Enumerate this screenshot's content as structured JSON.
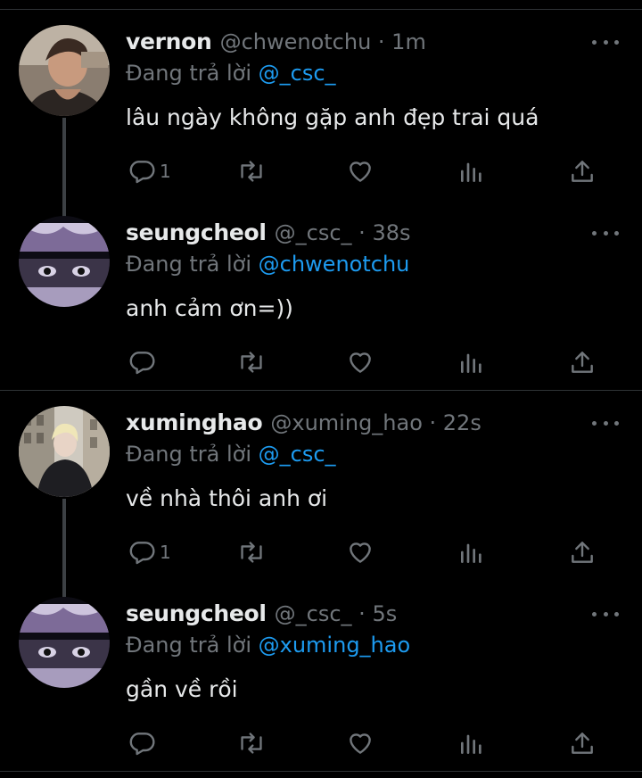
{
  "colors": {
    "background": "#000000",
    "text": "#e7e9ea",
    "muted": "#71767b",
    "link": "#1d9bf0"
  },
  "tweets": [
    {
      "name": "vernon",
      "handle": "@chwenotchu · 1m",
      "replying_prefix": "Đang trả lời ",
      "replying_to": "@_csc_",
      "text": "lâu ngày không gặp anh đẹp trai quá",
      "reply_count": "1"
    },
    {
      "name": "seungcheol",
      "handle": "@_csc_ · 38s",
      "replying_prefix": "Đang trả lời ",
      "replying_to": "@chwenotchu",
      "text": "anh cảm ơn=))",
      "reply_count": ""
    },
    {
      "name": "xuminghao",
      "handle": "@xuming_hao · 22s",
      "replying_prefix": "Đang trả lời ",
      "replying_to": "@_csc_",
      "text": "về nhà thôi anh ơi",
      "reply_count": "1"
    },
    {
      "name": "seungcheol",
      "handle": "@_csc_ · 5s",
      "replying_prefix": "Đang trả lời ",
      "replying_to": "@xuming_hao",
      "text": "gần về rồi",
      "reply_count": ""
    }
  ],
  "icons": {
    "reply": "reply-icon",
    "retweet": "retweet-icon",
    "like": "heart-icon",
    "views": "views-icon",
    "share": "share-icon",
    "more": "more-icon"
  }
}
